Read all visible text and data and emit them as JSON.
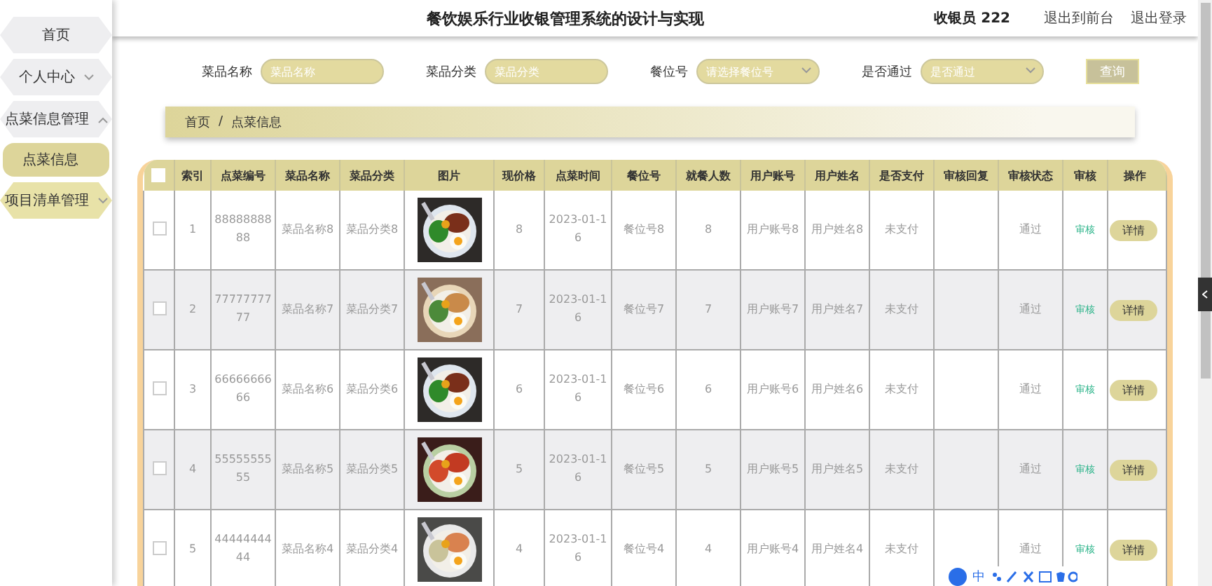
{
  "header": {
    "title": "餐饮娱乐行业收银管理系统的设计与实现",
    "user": "收银员 222",
    "links": [
      "退出到前台",
      "退出登录"
    ]
  },
  "sidebar": {
    "items": [
      {
        "label": "首页",
        "kind": "plain",
        "hover": false
      },
      {
        "label": "个人中心",
        "kind": "group",
        "expanded": false,
        "hover": false
      },
      {
        "label": "点菜信息管理",
        "kind": "group",
        "expanded": true,
        "hover": false,
        "children": [
          {
            "label": "点菜信息",
            "selected": true
          }
        ]
      },
      {
        "label": "项目清单管理",
        "kind": "group",
        "expanded": false,
        "hover": true
      }
    ]
  },
  "search": {
    "fields": [
      {
        "label": "菜品名称",
        "placeholder": "菜品名称",
        "kind": "input"
      },
      {
        "label": "菜品分类",
        "placeholder": "菜品分类",
        "kind": "input"
      },
      {
        "label": "餐位号",
        "placeholder": "请选择餐位号",
        "kind": "select"
      },
      {
        "label": "是否通过",
        "placeholder": "是否通过",
        "kind": "select"
      }
    ],
    "button": "查询"
  },
  "breadcrumb": {
    "items": [
      "首页",
      "点菜信息"
    ],
    "separator": "/"
  },
  "table": {
    "all_checked": false,
    "columns": [
      "索引",
      "点菜编号",
      "菜品名称",
      "菜品分类",
      "图片",
      "现价格",
      "点菜时间",
      "餐位号",
      "就餐人数",
      "用户账号",
      "用户姓名",
      "是否支付",
      "审核回复",
      "审核状态",
      "审核",
      "操作"
    ],
    "rows": [
      {
        "checked": false,
        "index": "1",
        "code": "8888888888",
        "name": "菜品名称8",
        "category": "菜品分类8",
        "price": "8",
        "time": "2023-01-16",
        "seat": "餐位号8",
        "diners": "8",
        "account": "用户账号8",
        "user": "用户姓名8",
        "paid": "未支付",
        "reply": "",
        "status": "通过",
        "audit": "审核",
        "action": "详情"
      },
      {
        "checked": false,
        "index": "2",
        "code": "7777777777",
        "name": "菜品名称7",
        "category": "菜品分类7",
        "price": "7",
        "time": "2023-01-16",
        "seat": "餐位号7",
        "diners": "7",
        "account": "用户账号7",
        "user": "用户姓名7",
        "paid": "未支付",
        "reply": "",
        "status": "通过",
        "audit": "审核",
        "action": "详情"
      },
      {
        "checked": false,
        "index": "3",
        "code": "6666666666",
        "name": "菜品名称6",
        "category": "菜品分类6",
        "price": "6",
        "time": "2023-01-16",
        "seat": "餐位号6",
        "diners": "6",
        "account": "用户账号6",
        "user": "用户姓名6",
        "paid": "未支付",
        "reply": "",
        "status": "通过",
        "audit": "审核",
        "action": "详情"
      },
      {
        "checked": false,
        "index": "4",
        "code": "5555555555",
        "name": "菜品名称5",
        "category": "菜品分类5",
        "price": "5",
        "time": "2023-01-16",
        "seat": "餐位号5",
        "diners": "5",
        "account": "用户账号5",
        "user": "用户姓名5",
        "paid": "未支付",
        "reply": "",
        "status": "通过",
        "audit": "审核",
        "action": "详情"
      },
      {
        "checked": false,
        "index": "5",
        "code": "4444444444",
        "name": "菜品名称4",
        "category": "菜品分类4",
        "price": "4",
        "time": "2023-01-16",
        "seat": "餐位号4",
        "diners": "4",
        "account": "用户账号4",
        "user": "用户姓名4",
        "paid": "未支付",
        "reply": "",
        "status": "通过",
        "audit": "审核",
        "action": "详情"
      }
    ]
  },
  "ime": {
    "label": "中"
  }
}
